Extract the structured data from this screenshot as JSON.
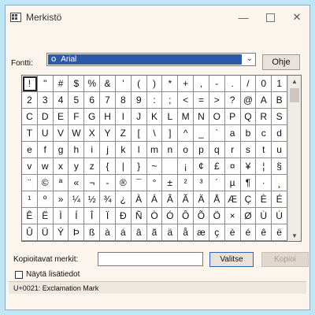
{
  "window": {
    "title": "Merkistö",
    "minimize_glyph": "—",
    "close_glyph": "✕"
  },
  "font": {
    "label": "Fontti:",
    "selected": "Arial",
    "icon": "O"
  },
  "help_button": "Ohje",
  "characters": [
    [
      "!",
      "\"",
      "#",
      "$",
      "%",
      "&",
      "'",
      "(",
      ")",
      "*",
      "+",
      ",",
      "-",
      ".",
      "/",
      "0",
      "1"
    ],
    [
      "2",
      "3",
      "4",
      "5",
      "6",
      "7",
      "8",
      "9",
      ":",
      ";",
      "<",
      "=",
      ">",
      "?",
      "@",
      "A",
      "B"
    ],
    [
      "C",
      "D",
      "E",
      "F",
      "G",
      "H",
      "I",
      "J",
      "K",
      "L",
      "M",
      "N",
      "O",
      "P",
      "Q",
      "R",
      "S"
    ],
    [
      "T",
      "U",
      "V",
      "W",
      "X",
      "Y",
      "Z",
      "[",
      "\\",
      "]",
      "^",
      "_",
      "`",
      "a",
      "b",
      "c",
      "d"
    ],
    [
      "e",
      "f",
      "g",
      "h",
      "i",
      "j",
      "k",
      "l",
      "m",
      "n",
      "o",
      "p",
      "q",
      "r",
      "s",
      "t",
      "u"
    ],
    [
      "v",
      "w",
      "x",
      "y",
      "z",
      "{",
      "|",
      "}",
      "~",
      " ",
      "¡",
      "¢",
      "£",
      "¤",
      "¥",
      "¦",
      "§"
    ],
    [
      "¨",
      "©",
      "ª",
      "«",
      "¬",
      "-",
      "®",
      "¯",
      "°",
      "±",
      "²",
      "³",
      "´",
      "µ",
      "¶",
      "·",
      "¸"
    ],
    [
      "¹",
      "º",
      "»",
      "¼",
      "½",
      "¾",
      "¿",
      "À",
      "Á",
      "Â",
      "Ã",
      "Ä",
      "Å",
      "Æ",
      "Ç",
      "È",
      "É"
    ],
    [
      "Ê",
      "Ë",
      "Ì",
      "Í",
      "Î",
      "Ï",
      "Ð",
      "Ñ",
      "Ò",
      "Ó",
      "Ô",
      "Õ",
      "Ö",
      "×",
      "Ø",
      "Ù",
      "Ú"
    ],
    [
      "Û",
      "Ü",
      "Ý",
      "Þ",
      "ß",
      "à",
      "á",
      "â",
      "ã",
      "ä",
      "å",
      "æ",
      "ç",
      "è",
      "é",
      "ê",
      "ë"
    ]
  ],
  "copy": {
    "label": "Kopioitavat merkit:",
    "value": "",
    "select_button": "Valitse",
    "copy_button": "Kopioi"
  },
  "advanced_view": {
    "label": "Näytä lisätiedot",
    "checked": false
  },
  "status": "U+0021: Exclamation Mark"
}
